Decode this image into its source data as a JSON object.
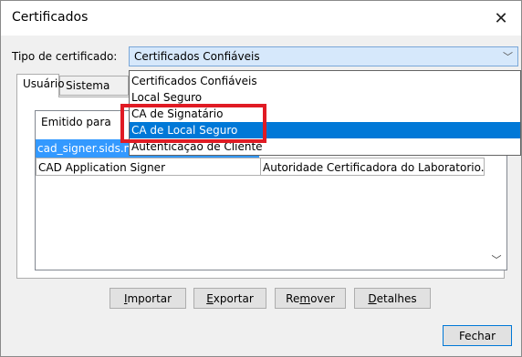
{
  "window": {
    "title": "Certificados",
    "close_glyph": "✕"
  },
  "cert_type": {
    "label": "Tipo de certificado:",
    "value": "Certificados Confiáveis"
  },
  "tabs": [
    {
      "label": "Usuário"
    },
    {
      "label": "Sistema"
    }
  ],
  "table": {
    "columns": [
      "Emitido para",
      ""
    ],
    "rows": [
      {
        "issued_to": "cad_signer.sids.n",
        "issued_by": ""
      },
      {
        "issued_to": "CAD Application Signer",
        "issued_by": "Autoridade Certificadora do Laboratorio..."
      }
    ]
  },
  "dropdown_options": [
    "Certificados Confiáveis",
    "Local Seguro",
    "CA de Signatário",
    "CA de Local Seguro",
    "Autenticação de Cliente"
  ],
  "buttons": {
    "import": {
      "mnemonic": "I",
      "rest": "mportar"
    },
    "export": {
      "mnemonic": "E",
      "rest": "xportar"
    },
    "remove": {
      "pre": "Re",
      "mnemonic": "m",
      "rest": "over"
    },
    "details": {
      "mnemonic": "D",
      "rest": "etalhes"
    },
    "close": "Fechar"
  },
  "colors": {
    "selection": "#0078d7",
    "highlight_box": "#e01b24",
    "combo_bg": "#d6e8fb"
  }
}
